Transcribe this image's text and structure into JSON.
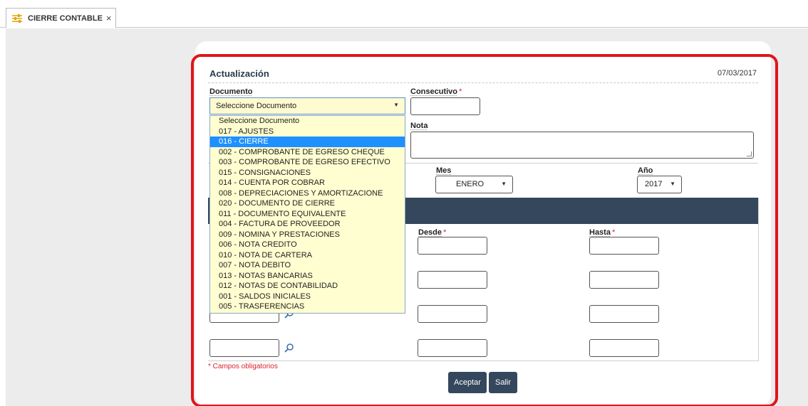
{
  "tab": {
    "label": "CIERRE CONTABLE",
    "close": "×",
    "icon": "sliders-icon"
  },
  "section": {
    "title": "Actualización",
    "date": "07/03/2017"
  },
  "fields": {
    "documento_label": "Documento",
    "documento_value": "Seleccione Documento",
    "consecutivo_label": "Consecutivo",
    "nota_label": "Nota",
    "mes_label": "Mes",
    "mes_value": "ENERO",
    "anio_label": "Año",
    "anio_value": "2017",
    "desde_label": "Desde",
    "hasta_label": "Hasta",
    "required_mark": "*"
  },
  "dropdown": {
    "options": [
      "Seleccione Documento",
      "017 - AJUSTES",
      "016 - CIERRE",
      "002 - COMPROBANTE DE EGRESO CHEQUE",
      "003 - COMPROBANTE DE EGRESO EFECTIVO",
      "015 - CONSIGNACIONES",
      "014 - CUENTA POR COBRAR",
      "008 - DEPRECIACIONES Y AMORTIZACIONE",
      "020 - DOCUMENTO DE CIERRE",
      "011 - DOCUMENTO EQUIVALENTE",
      "004 - FACTURA DE PROVEEDOR",
      "009 - NOMINA Y PRESTACIONES",
      "006 - NOTA CREDITO",
      "010 - NOTA DE CARTERA",
      "007 - NOTA DEBITO",
      "013 - NOTAS BANCARIAS",
      "012 - NOTAS DE CONTABILIDAD",
      "001 - SALDOS INICIALES",
      "005 - TRASFERENCIAS"
    ],
    "selected": "016 - CIERRE"
  },
  "footer": {
    "required_note": "* Campos obligatorios"
  },
  "buttons": {
    "accept": "Aceptar",
    "exit": "Salir"
  },
  "colors": {
    "accent_dark": "#34475d",
    "highlight_red": "#e0151b",
    "dropdown_bg": "#fffed0",
    "selected_blue": "#1e90ff"
  }
}
